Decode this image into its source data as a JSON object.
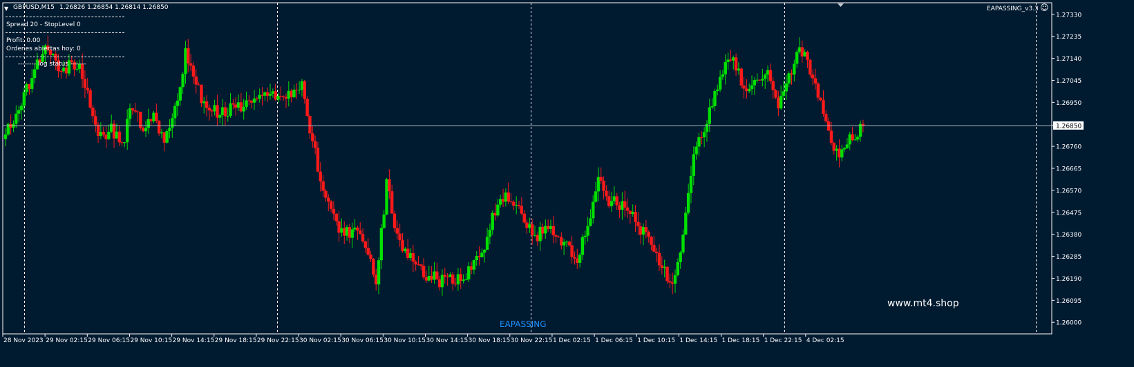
{
  "header": {
    "symbol": "GBPUSD,M15",
    "ohlc": "1.26826 1.26854 1.26814 1.26850",
    "indicator_name": "EAPASSING_v3.3",
    "smiley_icon": "smiley-icon",
    "menu_icon": "triangle-down-icon"
  },
  "panel": {
    "spread_line": "Spread 20 - StopLevel 0",
    "profit_line": "Profit: 0.00",
    "orders_line": "Ordenes abiertas hoy: 0",
    "log_line": "-------- log status -------"
  },
  "watermark": {
    "site": "www.mt4.shop",
    "brand": "EAPASSING"
  },
  "colors": {
    "background": "#001a30",
    "bull": "#00e000",
    "bear": "#ff1a1a",
    "grid": "#ffffff",
    "axis_text": "#ffffff",
    "brand": "#1e90ff"
  },
  "chart_data": {
    "type": "candlestick",
    "symbol": "GBPUSD",
    "timeframe": "M15",
    "current_price": "1.26850",
    "ylim": [
      1.2595,
      1.2738
    ],
    "y_ticks": [
      "1.27330",
      "1.27235",
      "1.27140",
      "1.27045",
      "1.26950",
      "1.26850",
      "1.26760",
      "1.26665",
      "1.26570",
      "1.26475",
      "1.26380",
      "1.26285",
      "1.26190",
      "1.26095",
      "1.26000"
    ],
    "x_ticks": [
      "28 Nov 2023",
      "29 Nov 02:15",
      "29 Nov 06:15",
      "29 Nov 10:15",
      "29 Nov 14:15",
      "29 Nov 18:15",
      "29 Nov 22:15",
      "30 Nov 02:15",
      "30 Nov 06:15",
      "30 Nov 10:15",
      "30 Nov 14:15",
      "30 Nov 18:15",
      "30 Nov 22:15",
      "1 Dec 02:15",
      "1 Dec 06:15",
      "1 Dec 10:15",
      "1 Dec 14:15",
      "1 Dec 18:15",
      "1 Dec 22:15",
      "4 Dec 02:15"
    ],
    "day_separators_after_tick": [
      0,
      6,
      12,
      18
    ],
    "close_path": [
      [
        0,
        1.2684
      ],
      [
        4,
        1.269
      ],
      [
        8,
        1.27
      ],
      [
        12,
        1.2712
      ],
      [
        16,
        1.272
      ],
      [
        20,
        1.2708
      ],
      [
        24,
        1.2711
      ],
      [
        28,
        1.2712
      ],
      [
        32,
        1.2693
      ],
      [
        36,
        1.268
      ],
      [
        40,
        1.2683
      ],
      [
        44,
        1.2676
      ],
      [
        48,
        1.2694
      ],
      [
        52,
        1.2682
      ],
      [
        56,
        1.269
      ],
      [
        60,
        1.2677
      ],
      [
        64,
        1.2691
      ],
      [
        68,
        1.2716
      ],
      [
        72,
        1.2703
      ],
      [
        76,
        1.2691
      ],
      [
        80,
        1.2691
      ],
      [
        84,
        1.2692
      ],
      [
        88,
        1.2693
      ],
      [
        92,
        1.2693
      ],
      [
        96,
        1.2697
      ],
      [
        100,
        1.27
      ],
      [
        104,
        1.2697
      ],
      [
        108,
        1.27
      ],
      [
        112,
        1.2703
      ],
      [
        116,
        1.2678
      ],
      [
        120,
        1.2658
      ],
      [
        124,
        1.2645
      ],
      [
        128,
        1.2638
      ],
      [
        132,
        1.2641
      ],
      [
        136,
        1.2632
      ],
      [
        140,
        1.2618
      ],
      [
        144,
        1.266
      ],
      [
        148,
        1.2638
      ],
      [
        152,
        1.2628
      ],
      [
        156,
        1.2624
      ],
      [
        160,
        1.262
      ],
      [
        164,
        1.2618
      ],
      [
        168,
        1.262
      ],
      [
        172,
        1.2618
      ],
      [
        176,
        1.2625
      ],
      [
        180,
        1.2628
      ],
      [
        184,
        1.2645
      ],
      [
        188,
        1.2655
      ],
      [
        192,
        1.2652
      ],
      [
        196,
        1.2645
      ],
      [
        200,
        1.2637
      ],
      [
        204,
        1.264
      ],
      [
        208,
        1.2638
      ],
      [
        212,
        1.2633
      ],
      [
        216,
        1.2628
      ],
      [
        220,
        1.2643
      ],
      [
        224,
        1.266
      ],
      [
        228,
        1.2653
      ],
      [
        232,
        1.2651
      ],
      [
        236,
        1.2649
      ],
      [
        240,
        1.264
      ],
      [
        244,
        1.2633
      ],
      [
        248,
        1.2625
      ],
      [
        252,
        1.2614
      ],
      [
        256,
        1.2635
      ],
      [
        260,
        1.2675
      ],
      [
        264,
        1.2683
      ],
      [
        268,
        1.27
      ],
      [
        272,
        1.2713
      ],
      [
        276,
        1.2711
      ],
      [
        280,
        1.2698
      ],
      [
        284,
        1.2705
      ],
      [
        288,
        1.2708
      ],
      [
        292,
        1.2695
      ],
      [
        296,
        1.2705
      ],
      [
        300,
        1.272
      ],
      [
        304,
        1.271
      ],
      [
        308,
        1.2695
      ],
      [
        312,
        1.2676
      ],
      [
        316,
        1.2673
      ],
      [
        320,
        1.268
      ],
      [
        324,
        1.2685
      ]
    ]
  }
}
